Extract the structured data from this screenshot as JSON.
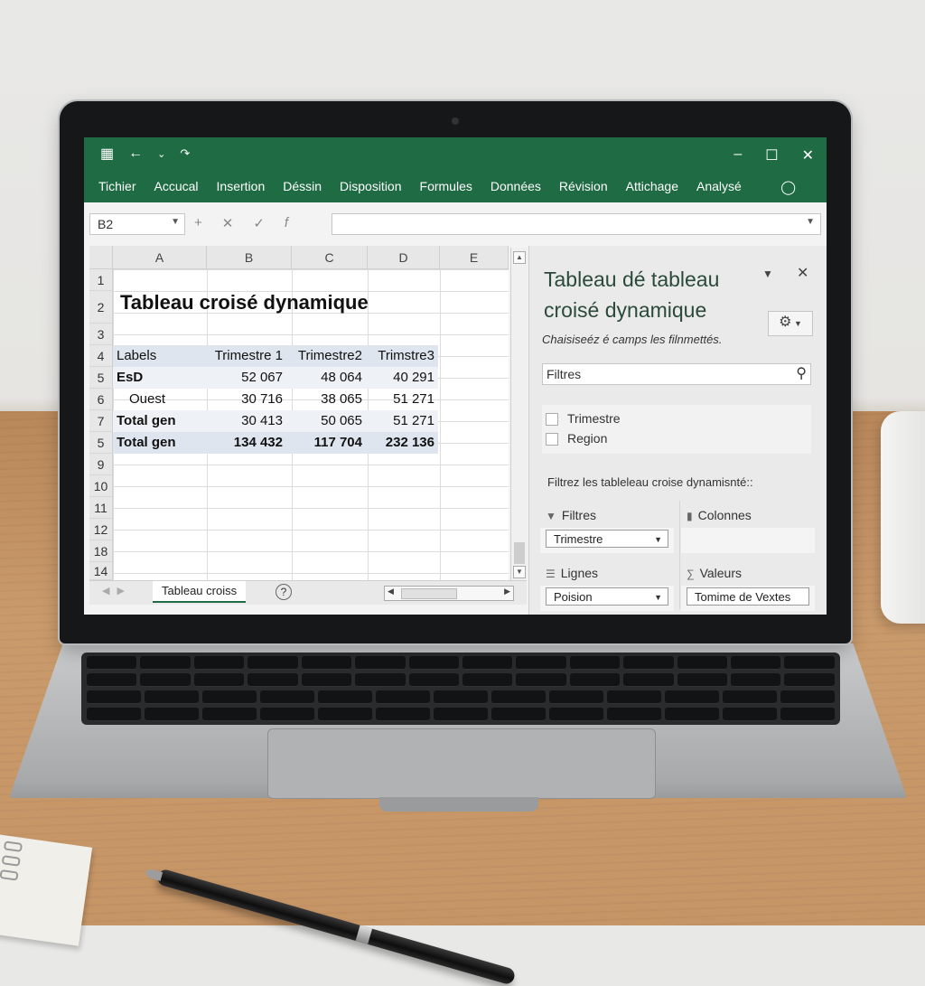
{
  "ribbon": {
    "menu": [
      "Tichier",
      "Accucal",
      "Insertion",
      "Déssin",
      "Disposition",
      "Formules",
      "Données",
      "Révision",
      "Attichage",
      "Analysé"
    ]
  },
  "formula_bar": {
    "name_box": "B2",
    "formula": ""
  },
  "sheet": {
    "columns": [
      "A",
      "B",
      "C",
      "D",
      "E"
    ],
    "rows": [
      "1",
      "2",
      "3",
      "4",
      "5",
      "6",
      "7",
      "5",
      "9",
      "10",
      "11",
      "12",
      "18",
      "14"
    ],
    "title": "Tableau croisé dynamique",
    "pivot": {
      "headers": [
        "Labels",
        "Trimestre 1",
        "Trimestre2",
        "Trimstre3"
      ],
      "rows": [
        {
          "label": "EsD",
          "values": [
            "52 067",
            "48 064",
            "40 291"
          ]
        },
        {
          "label": "Ouest",
          "values": [
            "30 716",
            "38 065",
            "51 271"
          ]
        },
        {
          "label": "Total gen",
          "values": [
            "30 413",
            "50 065",
            "51 271"
          ]
        },
        {
          "label": "Total gen",
          "values": [
            "134 432",
            "117 704",
            "232 136"
          ]
        }
      ]
    },
    "tab_label": "Tableau croiss",
    "help_glyph": "?"
  },
  "pane": {
    "title": "Tableau dé tableau croisé dynamique",
    "subtitle": "Chaisiseéz é camps les filnmettés.",
    "search_label": "Filtres",
    "fields": [
      "Trimestre",
      "Region"
    ],
    "hint": "Filtrez les tableleau croise dynamisnté::",
    "areas": {
      "filters": {
        "label": "Filtres",
        "value": "Trimestre"
      },
      "columns": {
        "label": "Colonnes",
        "value": ""
      },
      "rows": {
        "label": "Lignes",
        "value": "Poision"
      },
      "values": {
        "label": "Valeurs",
        "value": "Tomime de Vextes"
      }
    }
  },
  "colors": {
    "ribbon": "#1f6b43",
    "pivot_header": "#dfe5ee",
    "pane_title": "#2b4a3a"
  }
}
